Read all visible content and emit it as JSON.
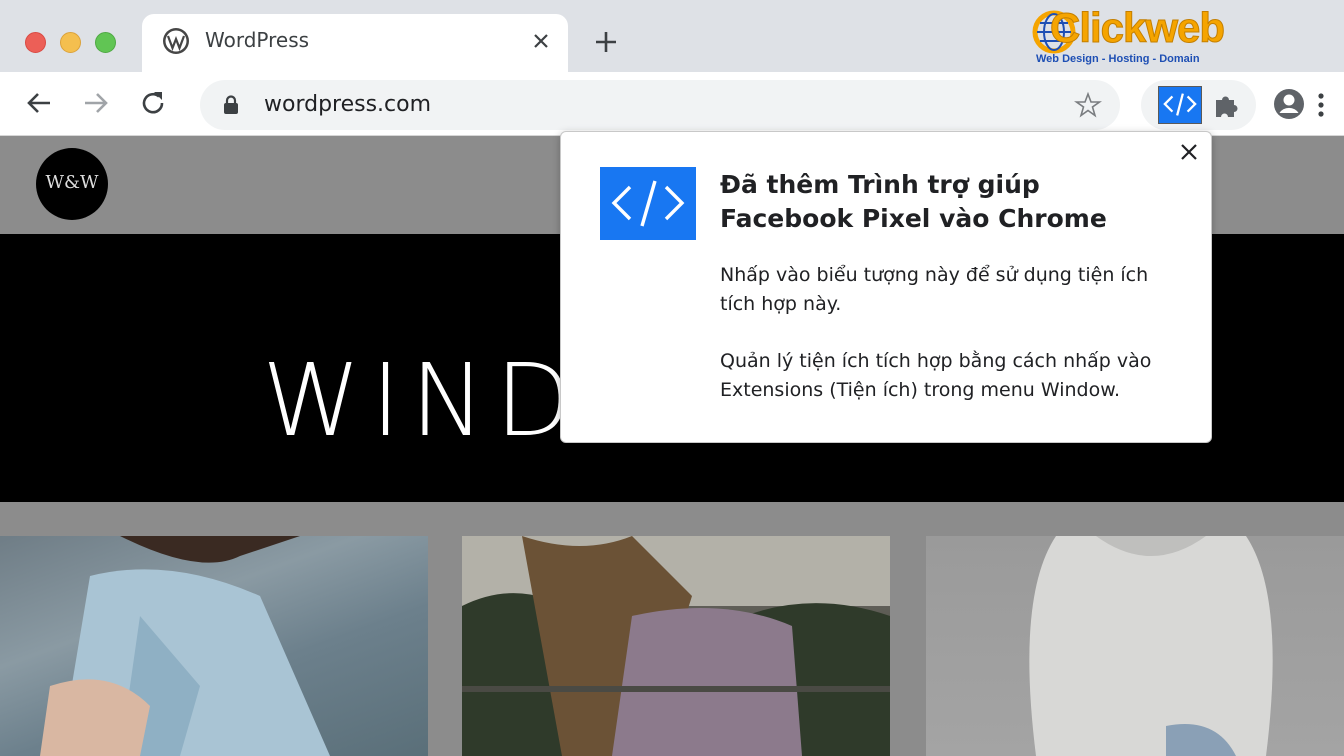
{
  "window": {
    "controls": [
      "close",
      "minimize",
      "zoom"
    ]
  },
  "tab": {
    "title": "WordPress",
    "favicon": "wordpress-icon",
    "close_icon": "close-icon"
  },
  "new_tab_icon": "plus-icon",
  "brand": {
    "name": "Clickweb",
    "tagline": "Web Design - Hosting - Domain"
  },
  "toolbar": {
    "back_icon": "arrow-left-icon",
    "forward_icon": "arrow-right-icon",
    "reload_icon": "reload-icon",
    "url": "wordpress.com",
    "lock_icon": "lock-icon",
    "bookmark_icon": "star-icon",
    "extension_icon": "code-brackets-icon",
    "extensions_menu_icon": "puzzle-icon",
    "profile_icon": "profile-icon",
    "menu_icon": "kebab-menu-icon"
  },
  "site": {
    "logo_text": "W&W",
    "hero_title": "WIND"
  },
  "popup": {
    "title": "Đã thêm Trình trợ giúp Facebook Pixel vào Chrome",
    "paragraph1": "Nhấp vào biểu tượng này để sử dụng tiện ích tích hợp này.",
    "paragraph2": "Quản lý tiện ích tích hợp bằng cách nhấp vào Extensions (Tiện ích) trong menu Window.",
    "close_icon": "close-icon"
  },
  "colors": {
    "tabstrip": "#dee1e6",
    "accent_blue": "#1877f2",
    "brand_orange": "#f5a400"
  }
}
